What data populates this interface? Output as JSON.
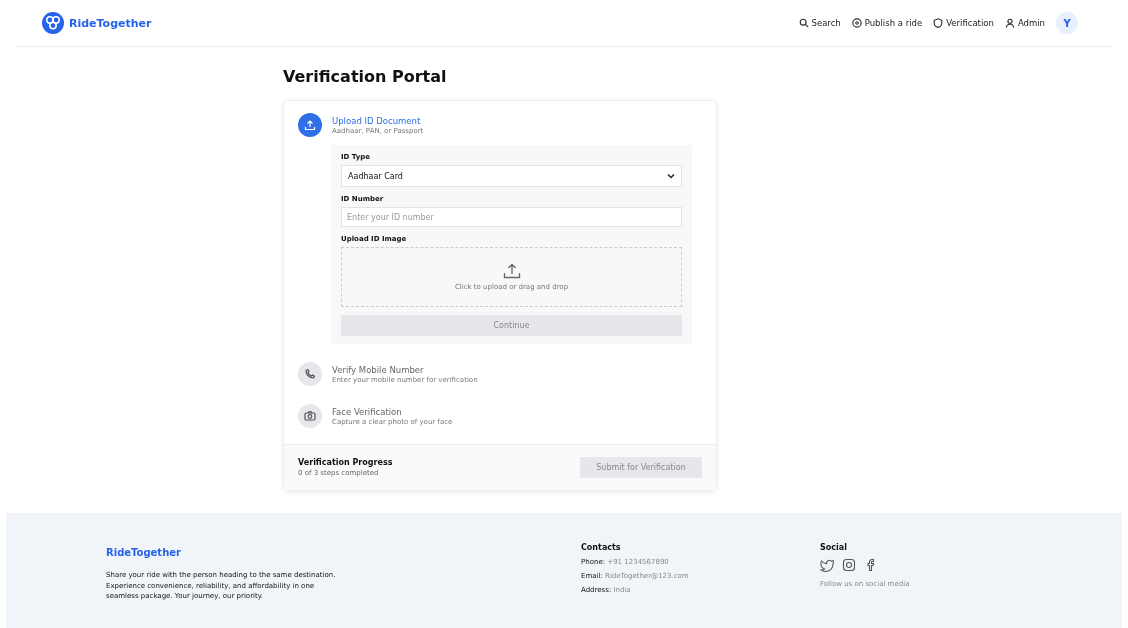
{
  "brand": "RideTogether",
  "nav": [
    {
      "label": "Search"
    },
    {
      "label": "Publish a ride"
    },
    {
      "label": "Verification"
    },
    {
      "label": "Admin"
    }
  ],
  "avatar": "Y",
  "title": "Verification Portal",
  "steps": [
    {
      "kind": "upload",
      "title": "Upload ID Document",
      "subtitle": "Aadhaar, PAN, or Passport",
      "selected": true
    },
    {
      "kind": "phone",
      "title": "Verify Mobile Number",
      "subtitle": "Enter your mobile number for verification",
      "selected": false
    },
    {
      "kind": "camera",
      "title": "Face Verification",
      "subtitle": "Capture a clear photo of your face",
      "selected": false
    }
  ],
  "form": {
    "id_type_label": "ID Type",
    "id_type_value": "Aadhaar Card",
    "id_number_label": "ID Number",
    "id_number_placeholder": "Enter your ID number",
    "image_label": "Upload ID Image",
    "dropzone_text": "Click to upload or drag and drop",
    "continue": "Continue",
    "continue_disabled": true
  },
  "progress": {
    "title": "Verification Progress",
    "text": "0 of 3 steps completed",
    "submit": "Submit for Verification",
    "submit_disabled": true
  },
  "footer": {
    "brand": "RideTogether",
    "about": "Share your ride with the person heading to the same destination. Experience convenience, reliability, and affordability in one seamless package. Your journey, our priority.",
    "contacts_title": "Contacts",
    "contacts": [
      {
        "label": "Phone:",
        "value": "+91 1234567890"
      },
      {
        "label": "Email:",
        "value": "RideTogether@123.com"
      },
      {
        "label": "Address:",
        "value": "India"
      }
    ],
    "social_title": "Social",
    "social_text": "Follow us on social media"
  }
}
